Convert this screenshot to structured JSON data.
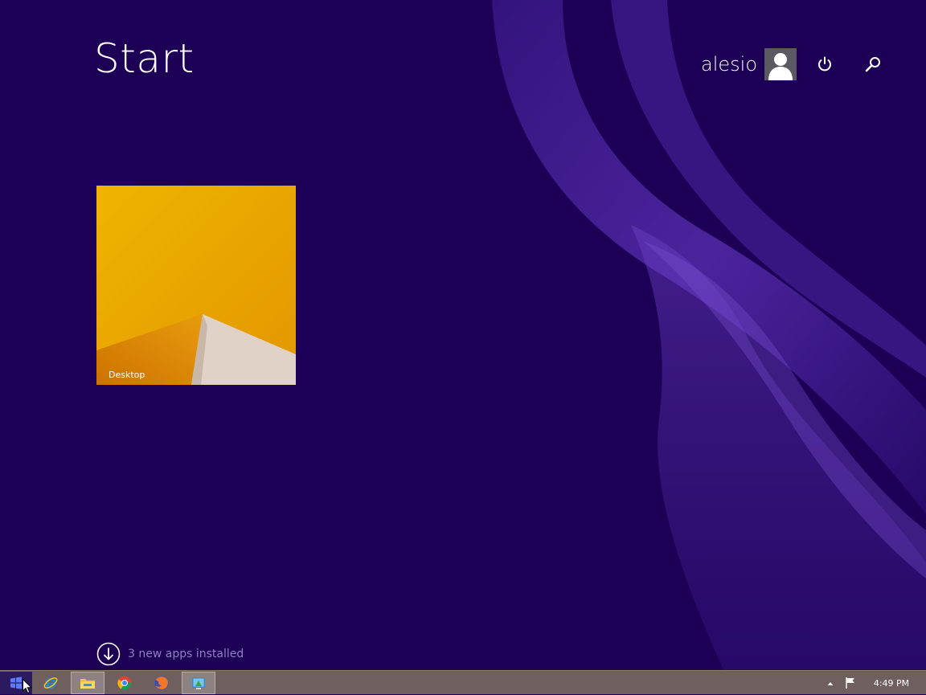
{
  "start_screen": {
    "title": "Start",
    "background_color": "#1d0055",
    "accent_color": "#5a2fb0"
  },
  "user": {
    "name": "alesio",
    "avatar_icon": "user-silhouette-icon"
  },
  "top_controls": {
    "power_icon": "power-icon",
    "search_icon": "search-icon"
  },
  "tiles": [
    {
      "label": "Desktop",
      "background_color": "#e7a800"
    }
  ],
  "new_apps": {
    "text": "3 new apps installed",
    "icon": "down-arrow-circle-icon"
  },
  "taskbar": {
    "background_color": "#6f5f5e",
    "items": [
      {
        "name": "Start",
        "icon": "windows-logo-icon"
      },
      {
        "name": "Internet Explorer",
        "icon": "internet-explorer-icon"
      },
      {
        "name": "File Explorer",
        "icon": "file-explorer-icon",
        "active": true
      },
      {
        "name": "Google Chrome",
        "icon": "chrome-icon"
      },
      {
        "name": "Firefox",
        "icon": "firefox-icon"
      },
      {
        "name": "App",
        "icon": "app-icon",
        "active": true
      }
    ],
    "tray": {
      "chevron_icon": "chevron-up-icon",
      "flag_icon": "action-center-flag-icon",
      "clock": "4:49 PM"
    }
  }
}
